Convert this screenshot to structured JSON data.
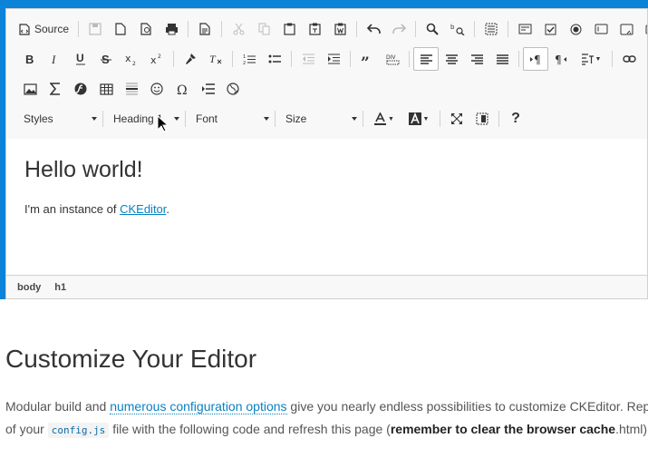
{
  "toolbar": {
    "source_label": "Source",
    "row1_icons": [
      "save-icon",
      "new-page-icon",
      "preview-icon",
      "print-icon",
      "templates-icon",
      "cut-icon",
      "copy-icon",
      "paste-icon",
      "paste-text-icon",
      "paste-word-icon",
      "undo-icon",
      "redo-icon",
      "find-icon",
      "replace-icon",
      "select-all-icon",
      "form-icon",
      "checkbox-icon",
      "radio-icon",
      "text-field-icon",
      "textarea-icon",
      "select-field-icon"
    ],
    "combos": {
      "styles": "Styles",
      "format": "Heading 1",
      "font": "Font",
      "size": "Size"
    },
    "help_glyph": "?"
  },
  "content": {
    "heading": "Hello world!",
    "para_prefix": "I'm an instance of ",
    "link_text": "CKEditor",
    "para_suffix": "."
  },
  "statusbar": {
    "path": [
      "body",
      "h1"
    ]
  },
  "page": {
    "section_title": "Customize Your Editor",
    "line1_a": "Modular build and ",
    "line1_link": "numerous configuration options",
    "line1_b": " give you nearly endless possibilities to customize CKEditor. Replace the content",
    "line2_a": "of your ",
    "line2_code": "config.js",
    "line2_b": " file with the following code and refresh this page (",
    "line2_strong": "remember to clear the browser cache",
    "line2_c": ".html)"
  },
  "colors": {
    "accent_blue": "#0a83d8",
    "link": "#0782c1",
    "toolbar_bg": "#f8f8f8"
  }
}
